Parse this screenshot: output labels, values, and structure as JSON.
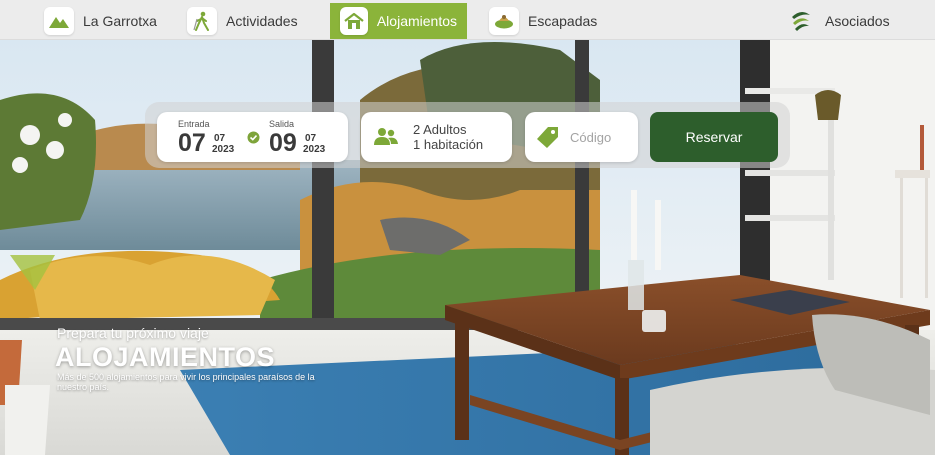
{
  "nav": {
    "items": [
      {
        "label": "La Garrotxa",
        "icon": "mountain-icon"
      },
      {
        "label": "Actividades",
        "icon": "hiker-icon"
      },
      {
        "label": "Alojamientos",
        "icon": "house-icon",
        "active": true
      },
      {
        "label": "Escapadas",
        "icon": "escapadas-icon"
      },
      {
        "label": "Asociados",
        "icon": "asociados-logo-icon"
      }
    ]
  },
  "booking": {
    "checkin": {
      "label": "Entrada",
      "day": "07",
      "month": "07",
      "year": "2023"
    },
    "checkout": {
      "label": "Salida",
      "day": "09",
      "month": "07",
      "year": "2023"
    },
    "guests": {
      "adults": "2 Adultos",
      "rooms": "1 habitación"
    },
    "code_placeholder": "Código",
    "reserve_label": "Reservar"
  },
  "hero": {
    "subtitle": "Prepara tu próximo viaje",
    "title": "ALOJAMIENTOS",
    "description": "Más de 500 alojamientos para vivir los principales paraísos de la nuestro país."
  },
  "colors": {
    "active_nav": "#8bb43a",
    "brand_green": "#2d5e2c",
    "check_green": "#7ea43a",
    "icon_green": "#7da838"
  }
}
